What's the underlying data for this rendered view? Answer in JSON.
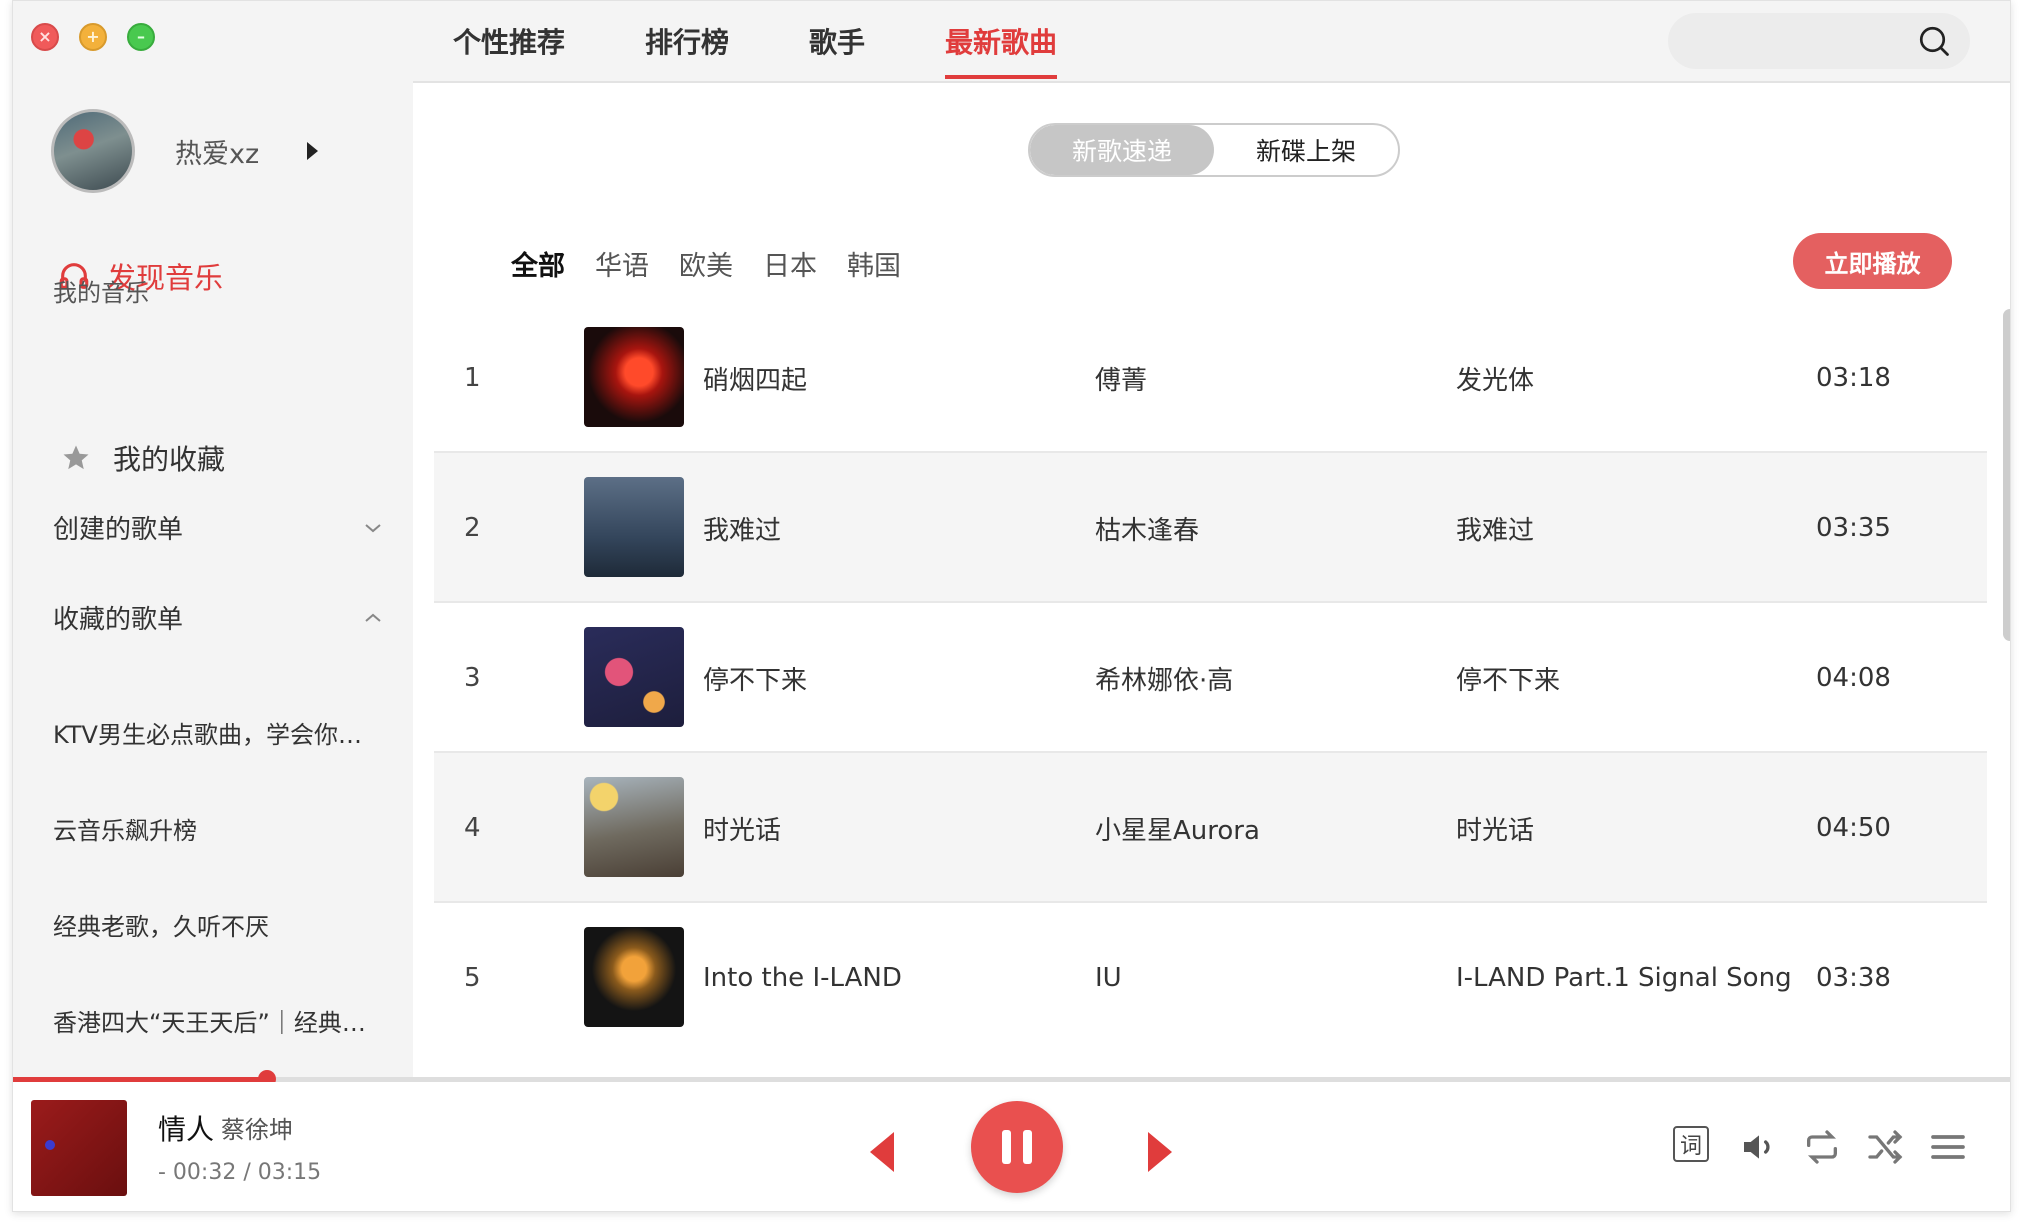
{
  "nav": {
    "tabs": [
      "个性推荐",
      "排行榜",
      "歌手",
      "最新歌曲"
    ],
    "active_index": 3
  },
  "user": {
    "name": "热爱xz"
  },
  "sidebar": {
    "discover": "发现音乐",
    "my_music": "我的音乐",
    "favorites": "我的收藏",
    "created_playlists": "创建的歌单",
    "collected_playlists": "收藏的歌单",
    "playlists": [
      "KTV男生必点歌曲，学会你…",
      "云音乐飙升榜",
      "经典老歌，久听不厌",
      "香港四大“天王天后”｜经典…"
    ]
  },
  "segment": {
    "options": [
      "新歌速递",
      "新碟上架"
    ],
    "active_index": 0
  },
  "filters": {
    "options": [
      "全部",
      "华语",
      "欧美",
      "日本",
      "韩国"
    ],
    "active_index": 0
  },
  "play_now": "立即播放",
  "songs": [
    {
      "index": "1",
      "title": "硝烟四起",
      "artist": "傅菁",
      "album": "发光体",
      "duration": "03:18",
      "cover": "cover-red-orbit"
    },
    {
      "index": "2",
      "title": "我难过",
      "artist": "枯木逢春",
      "album": "我难过",
      "duration": "03:35",
      "cover": "cover-dark-blue-figure"
    },
    {
      "index": "3",
      "title": "停不下来",
      "artist": "希林娜依·高",
      "album": "停不下来",
      "duration": "04:08",
      "cover": "cover-cartoon-planet"
    },
    {
      "index": "4",
      "title": "时光话",
      "artist": "小星星Aurora",
      "album": "时光话",
      "duration": "04:50",
      "cover": "cover-illustrated-houses"
    },
    {
      "index": "5",
      "title": "Into the I-LAND",
      "artist": "IU",
      "album": "I-LAND Part.1 Signal Song",
      "duration": "03:38",
      "cover": "cover-gold-cube"
    }
  ],
  "player": {
    "title": "情人",
    "artist": "蔡徐坤",
    "time": "- 00:32 / 03:15",
    "progress": 0.127,
    "lyric_label": "词"
  },
  "colors": {
    "accent": "#e03c3c",
    "sidebar_bg": "#f4f4f4",
    "row_alt_bg": "#f5f5f5"
  }
}
